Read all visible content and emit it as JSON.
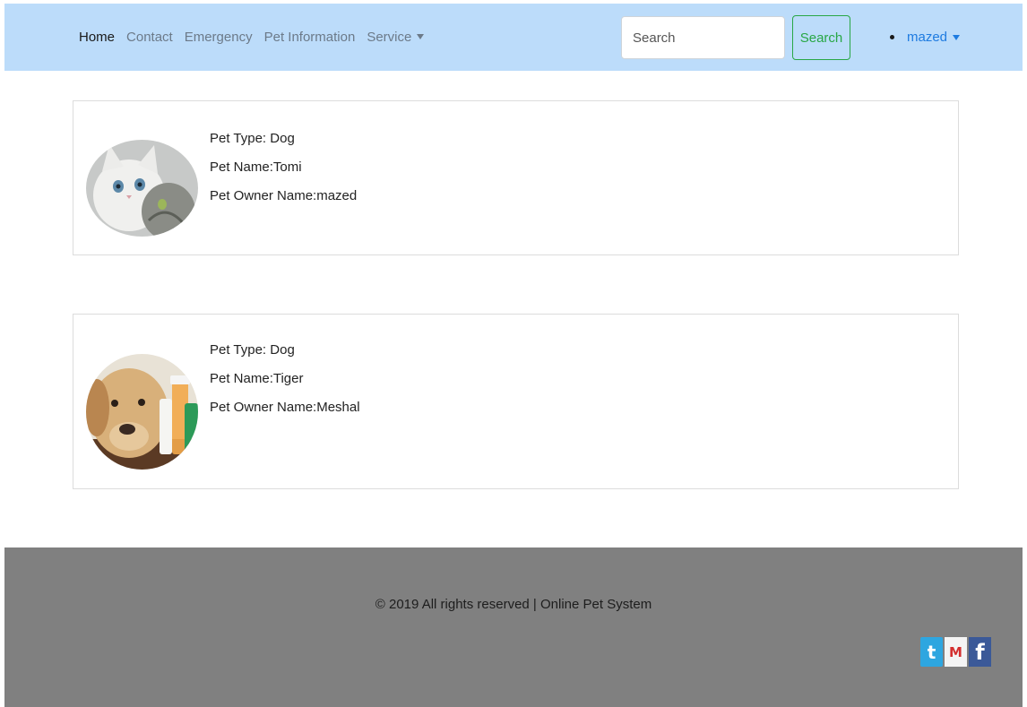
{
  "nav": {
    "links": [
      {
        "label": "Home"
      },
      {
        "label": "Contact"
      },
      {
        "label": "Emergency"
      },
      {
        "label": "Pet Information"
      },
      {
        "label": "Service"
      }
    ],
    "search_placeholder": "Search",
    "search_button": "Search",
    "user_name": "mazed"
  },
  "pets": [
    {
      "type": "Pet Type: Dog",
      "name": "Pet Name:Tomi",
      "owner": "Pet Owner Name:mazed",
      "image_icon": "cat-photo"
    },
    {
      "type": "Pet Type: Dog",
      "name": "Pet Name:Tiger",
      "owner": "Pet Owner Name:Meshal",
      "image_icon": "dog-photo"
    }
  ],
  "footer": {
    "copyright": "© 2019 All rights reserved | Online Pet System",
    "social": [
      {
        "icon": "twitter-icon",
        "glyph": "t"
      },
      {
        "icon": "gmail-icon",
        "glyph": "M"
      },
      {
        "icon": "facebook-icon",
        "glyph": "f"
      }
    ]
  },
  "colors": {
    "navbar_bg": "#bcdcfa",
    "footer_bg": "#808080",
    "accent_green": "#28a745",
    "accent_blue": "#1e7be0"
  }
}
